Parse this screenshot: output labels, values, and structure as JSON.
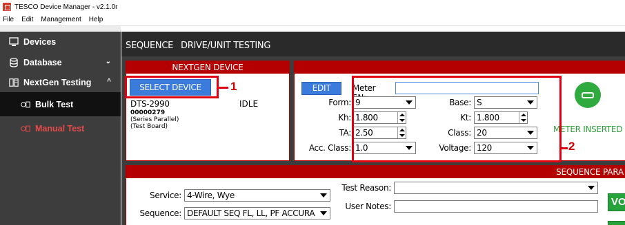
{
  "app": {
    "title": "TESCO Device Manager - v2.1.0r"
  },
  "menu": [
    "File",
    "Edit",
    "Management",
    "Help"
  ],
  "sidebar": {
    "items": [
      {
        "label": "Devices",
        "icon": "monitor-icon"
      },
      {
        "label": "Database",
        "icon": "database-icon",
        "chevron": "⌄"
      },
      {
        "label": "NextGen Testing",
        "icon": "nextgen-icon",
        "chevron": "^"
      },
      {
        "label": "Bulk Test",
        "icon": "bulk-test-icon"
      },
      {
        "label": "Manual Test",
        "icon": "manual-test-icon"
      }
    ],
    "manual_color": "#e84a4a"
  },
  "tabs": {
    "sequence": "SEQUENCE",
    "drive": "DRIVE/UNIT TESTING"
  },
  "device_panel": {
    "header": "NEXTGEN DEVICE",
    "select_button": "SELECT DEVICE",
    "device_name": "DTS-2990",
    "device_status": "IDLE",
    "serial": "00000279",
    "config": "(Series Parallel)",
    "board": "(Test Board)"
  },
  "meter_panel": {
    "edit_button": "EDIT",
    "meter_sn_label": "Meter SN:",
    "meter_sn_value": "",
    "form_label": "Form:",
    "form_value": "9",
    "base_label": "Base:",
    "base_value": "S",
    "kh_label": "Kh:",
    "kh_value": "1.800",
    "kt_label": "Kt:",
    "kt_value": "1.800",
    "ta_label": "TA:",
    "ta_value": "2.50",
    "class_label": "Class:",
    "class_value": "20",
    "acc_class_label": "Acc. Class:",
    "acc_class_value": "1.0",
    "voltage_label": "Voltage:",
    "voltage_value": "120",
    "status": "METER INSERTED"
  },
  "callouts": {
    "one": "1",
    "two": "2"
  },
  "sequence_panel": {
    "header": "SEQUENCE PARA",
    "service_label": "Service:",
    "service_value": "4-Wire, Wye",
    "sequence_label": "Sequence:",
    "sequence_value": "DEFAULT SEQ FL, LL, PF ACCURA",
    "test_reason_label": "Test Reason:",
    "test_reason_value": "",
    "user_notes_label": "User Notes:",
    "user_notes_value": "",
    "green_button": "VO"
  }
}
